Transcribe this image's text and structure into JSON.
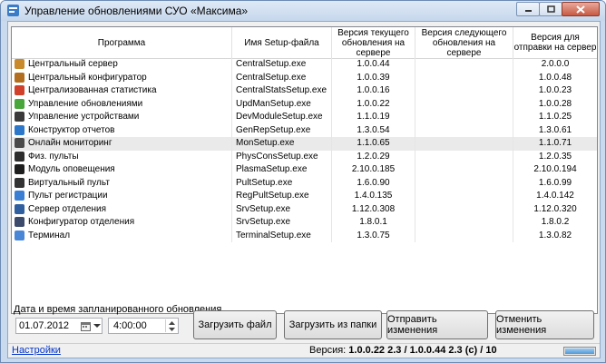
{
  "window": {
    "title": "Управление обновлениями СУО «Максима»"
  },
  "table": {
    "columns": [
      "Программа",
      "Имя Setup-файла",
      "Версия текущего обновления на сервере",
      "Версия следующего обновления на сервере",
      "Версия для отправки на сервер"
    ],
    "rows": [
      {
        "program": "Центральный сервер",
        "setup": "CentralSetup.exe",
        "current": "1.0.0.44",
        "next": "",
        "send": "2.0.0.0",
        "icon": "server-icon",
        "color": "#c98a2b"
      },
      {
        "program": "Центральный конфигуратор",
        "setup": "CentralSetup.exe",
        "current": "1.0.0.39",
        "next": "",
        "send": "1.0.0.48",
        "icon": "configurator-icon",
        "color": "#b36d1e"
      },
      {
        "program": "Централизованная статистика",
        "setup": "CentralStatsSetup.exe",
        "current": "1.0.0.16",
        "next": "",
        "send": "1.0.0.23",
        "icon": "statistics-icon",
        "color": "#d0402a"
      },
      {
        "program": "Управление обновлениями",
        "setup": "UpdManSetup.exe",
        "current": "1.0.0.22",
        "next": "",
        "send": "1.0.0.28",
        "icon": "update-icon",
        "color": "#48a63a"
      },
      {
        "program": "Управление устройствами",
        "setup": "DevModuleSetup.exe",
        "current": "1.1.0.19",
        "next": "",
        "send": "1.1.0.25",
        "icon": "devices-icon",
        "color": "#3a3a3a"
      },
      {
        "program": "Конструктор отчетов",
        "setup": "GenRepSetup.exe",
        "current": "1.3.0.54",
        "next": "",
        "send": "1.3.0.61",
        "icon": "report-icon",
        "color": "#2c77c9"
      },
      {
        "program": "Онлайн мониторинг",
        "setup": "MonSetup.exe",
        "current": "1.1.0.65",
        "next": "",
        "send": "1.1.0.71",
        "icon": "monitoring-icon",
        "color": "#4a4a4a"
      },
      {
        "program": "Физ. пульты",
        "setup": "PhysConsSetup.exe",
        "current": "1.2.0.29",
        "next": "",
        "send": "1.2.0.35",
        "icon": "keypad-icon",
        "color": "#2d2d2d"
      },
      {
        "program": "Модуль оповещения",
        "setup": "PlasmaSetup.exe",
        "current": "2.10.0.185",
        "next": "",
        "send": "2.10.0.194",
        "icon": "plasma-icon",
        "color": "#1e1e1e"
      },
      {
        "program": "Виртуальный пульт",
        "setup": "PultSetup.exe",
        "current": "1.6.0.90",
        "next": "",
        "send": "1.6.0.99",
        "icon": "virtual-pult-icon",
        "color": "#333333"
      },
      {
        "program": "Пульт регистрации",
        "setup": "RegPultSetup.exe",
        "current": "1.4.0.135",
        "next": "",
        "send": "1.4.0.142",
        "icon": "registration-icon",
        "color": "#3b7fd4"
      },
      {
        "program": "Сервер отделения",
        "setup": "SrvSetup.exe",
        "current": "1.12.0.308",
        "next": "",
        "send": "1.12.0.320",
        "icon": "branch-server-icon",
        "color": "#2f5f9e"
      },
      {
        "program": "Конфигуратор отделения",
        "setup": "SrvSetup.exe",
        "current": "1.8.0.1",
        "next": "",
        "send": "1.8.0.2",
        "icon": "branch-config-icon",
        "color": "#3c4a6b"
      },
      {
        "program": "Терминал",
        "setup": "TerminalSetup.exe",
        "current": "1.3.0.75",
        "next": "",
        "send": "1.3.0.82",
        "icon": "terminal-icon",
        "color": "#4a86d6"
      }
    ]
  },
  "schedule": {
    "label": "Дата и время запланированного обновления",
    "date": "01.07.2012",
    "time": "4:00:00"
  },
  "buttons": {
    "load_file": "Загрузить файл",
    "load_folder": "Загрузить из папки",
    "send": "Отправить изменения",
    "cancel": "Отменить изменения"
  },
  "status": {
    "settings": "Настройки",
    "version_label": "Версия:",
    "version_value": "1.0.0.22 2.3 / 1.0.0.44 2.3 (c) / 10",
    "progress": 1.0
  },
  "selected_row": 6
}
